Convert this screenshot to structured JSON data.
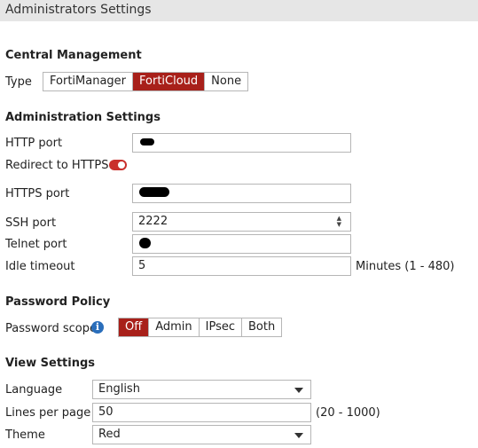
{
  "header": {
    "title": "Administrators Settings"
  },
  "central_management": {
    "section_title": "Central Management",
    "type_label": "Type",
    "options": [
      "FortiManager",
      "FortiCloud",
      "None"
    ],
    "selected": "FortiCloud"
  },
  "administration": {
    "section_title": "Administration Settings",
    "http_port_label": "HTTP port",
    "http_port_value": "",
    "redirect_label": "Redirect to HTTPS",
    "redirect_enabled": true,
    "https_port_label": "HTTPS port",
    "https_port_value": "",
    "ssh_port_label": "SSH port",
    "ssh_port_value": "2222",
    "telnet_port_label": "Telnet port",
    "telnet_port_value": "",
    "idle_timeout_label": "Idle timeout",
    "idle_timeout_value": "5",
    "idle_timeout_hint": "Minutes (1 - 480)"
  },
  "password_policy": {
    "section_title": "Password Policy",
    "scope_label": "Password scope",
    "options": [
      "Off",
      "Admin",
      "IPsec",
      "Both"
    ],
    "selected": "Off"
  },
  "view_settings": {
    "section_title": "View Settings",
    "language_label": "Language",
    "language_value": "English",
    "lines_per_page_label": "Lines per page",
    "lines_per_page_value": "50",
    "lines_per_page_hint": "(20 - 1000)",
    "theme_label": "Theme",
    "theme_value": "Red"
  },
  "colors": {
    "accent": "#a8201a",
    "toggle_on": "#c9302c",
    "info": "#2a6ebb"
  },
  "icons": {
    "info": "info-icon",
    "toggle": "toggle-switch",
    "dropdown": "chevron-down-icon",
    "spinner": "number-spinner-icon"
  }
}
